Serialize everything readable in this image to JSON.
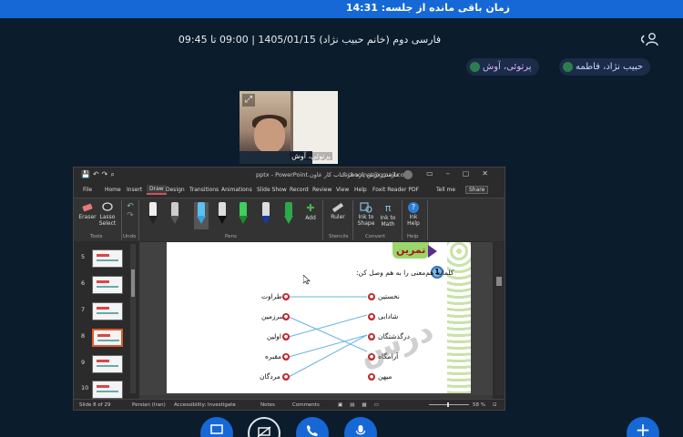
{
  "header": {
    "timer_text": "زمان باقی مانده از جلسه: 14:31"
  },
  "session": {
    "title": "فارسی دوم (خانم حبیب نژاد) 1405/01/15 | 09:00 تا 09:45"
  },
  "participants": [
    {
      "name": "حبیب نژاد، فاطمه"
    },
    {
      "name": "پرتوئی، آوش"
    }
  ],
  "webcam": {
    "name_label": "پرتوئی، آوش"
  },
  "powerpoint": {
    "doc_title": "فارسی درس پاره هر کتاب کار عاون.pptx - PowerPoint",
    "account": "schoolnet@gmail.com",
    "tabs": [
      "File",
      "Home",
      "Insert",
      "Draw",
      "Design",
      "Transitions",
      "Animations",
      "Slide Show",
      "Record",
      "Review",
      "View",
      "Help",
      "Foxit Reader PDF",
      "Tell me",
      "Share"
    ],
    "ribbon": {
      "eraser": "Eraser",
      "lasso": "Lasso Select",
      "add": "Add",
      "ruler": "Ruler",
      "ink_to_shape": "Ink to Shape",
      "ink_to_math": "Ink to Math",
      "ink_help": "Ink Help",
      "groups": {
        "tools": "Tools",
        "undo": "Undo",
        "pens": "Pens",
        "stencils": "Stencils",
        "convert": "Convert",
        "help": "Help"
      }
    },
    "thumbnails": [
      "5",
      "6",
      "7",
      "8",
      "9",
      "10"
    ],
    "slide": {
      "banner": "تمرین",
      "number": "1",
      "instruction": "کلمات هم‌معنی را به هم وصل کن:",
      "right_words": [
        "نخستین",
        "شادابی",
        "درگذشتگان",
        "آرامگاه",
        "میهن"
      ],
      "left_words": [
        "طراوت",
        "سرزمین",
        "اولین",
        "مقبره",
        "مردگان"
      ],
      "watermark": "درس"
    },
    "status": {
      "slide_info": "Slide 8 of 29",
      "language": "Persian (Iran)",
      "accessibility": "Accessibility: Investigate",
      "notes": "Notes",
      "comments": "Comments",
      "zoom": "58 %"
    }
  },
  "controls": {
    "screen_icon": "screen-icon",
    "desktop_share_icon": "desktop-share-icon",
    "phone_icon": "phone-icon",
    "mic_icon": "mic-icon",
    "plus_icon": "plus-icon"
  }
}
